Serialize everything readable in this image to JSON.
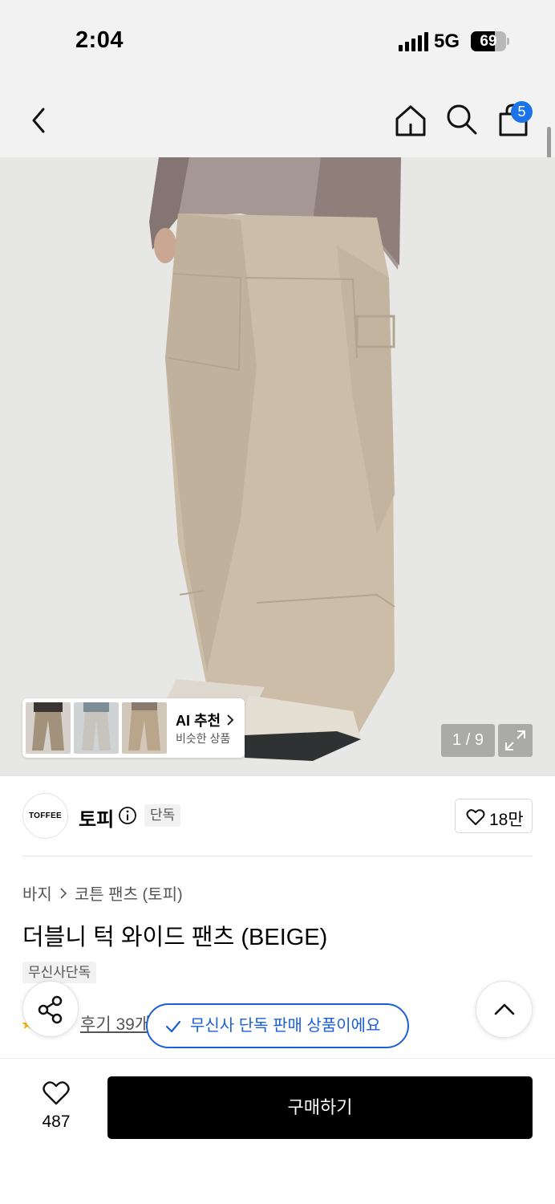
{
  "status_bar": {
    "time": "2:04",
    "network": "5G",
    "battery": "69",
    "battery_level": 0.69
  },
  "header": {
    "cart_count": "5",
    "icons": [
      "back-icon",
      "home-icon",
      "search-icon",
      "cart-icon"
    ]
  },
  "gallery": {
    "ai_title": "AI 추천",
    "ai_subtitle": "비슷한 상품",
    "pager": "1 / 9"
  },
  "brand": {
    "logo_text": "TOFFEE",
    "name": "토피",
    "exclusive": "단독",
    "likes": "18만"
  },
  "product": {
    "category": "바지",
    "subcategory": "코튼 팬츠 (토피)",
    "title": "더블니 턱 와이드 팬츠 (BEIGE)",
    "badge": "무신사단독",
    "review": "후기 39개"
  },
  "toast": {
    "text": "무신사 단독 판매 상품이에요"
  },
  "bottom_bar": {
    "wish_count": "487",
    "buy_label": "구매하기"
  },
  "colors": {
    "accent_blue": "#1a5fd8",
    "badge_blue": "#1a73e8",
    "buy_button": "#000000",
    "pants_beige": "#cbbda8"
  }
}
